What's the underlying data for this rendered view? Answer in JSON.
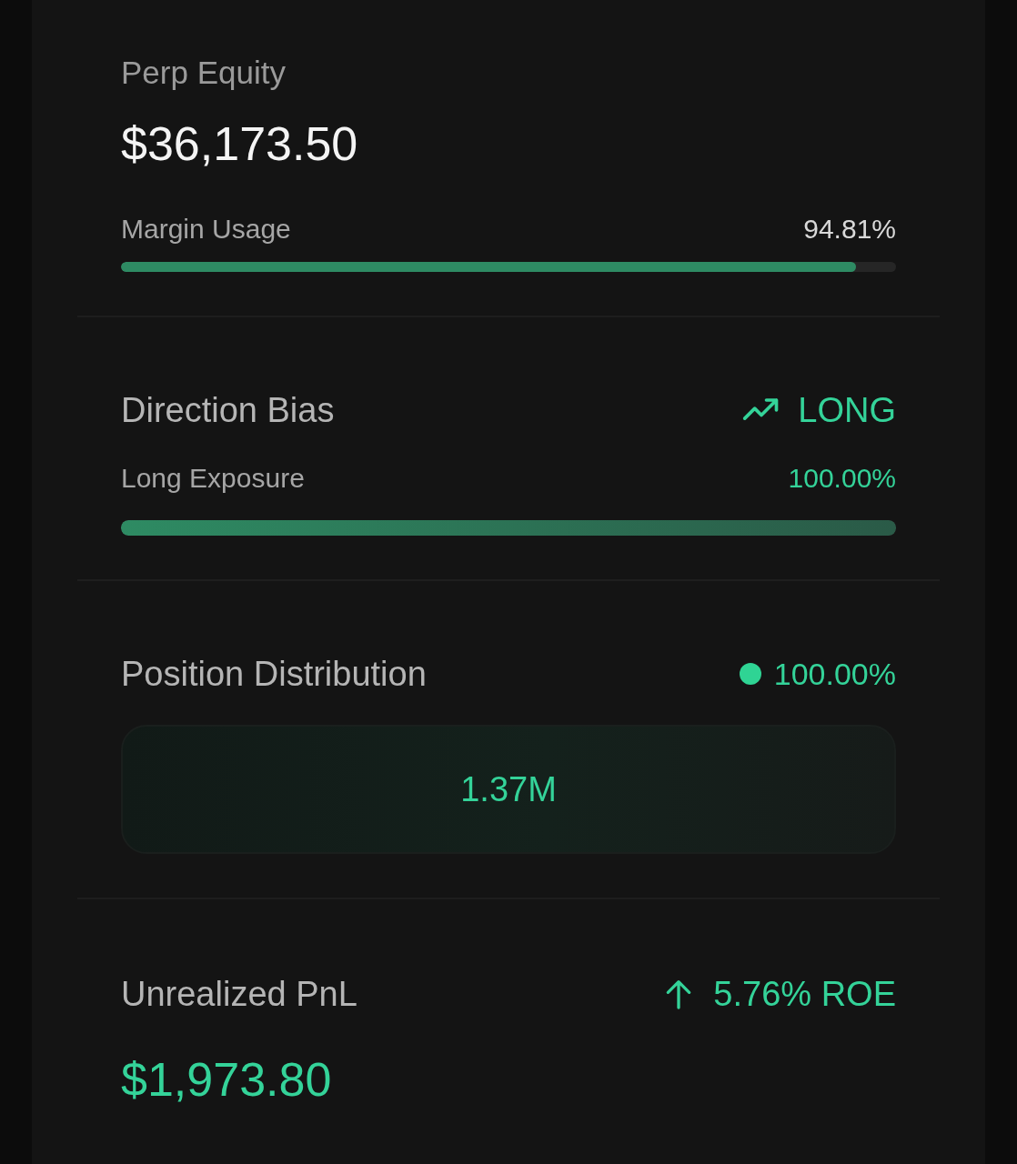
{
  "equity": {
    "label": "Perp Equity",
    "value": "$36,173.50",
    "meter": {
      "label": "Margin Usage",
      "reading": "94.81%",
      "level": 0.9481
    }
  },
  "bias": {
    "title": "Direction Bias",
    "text": "LONG",
    "meter": {
      "label": "Long Exposure",
      "reading": "100.00%",
      "level": 1.0
    }
  },
  "distribution": {
    "title": "Position Distribution",
    "legend": [
      {
        "color": "#2fd494",
        "text": "100.00%"
      }
    ],
    "segments": [
      {
        "label": "1.37M"
      }
    ]
  },
  "pnl": {
    "title": "Unrealized PnL",
    "roe": "5.76% ROE",
    "value": "$1,973.80"
  }
}
